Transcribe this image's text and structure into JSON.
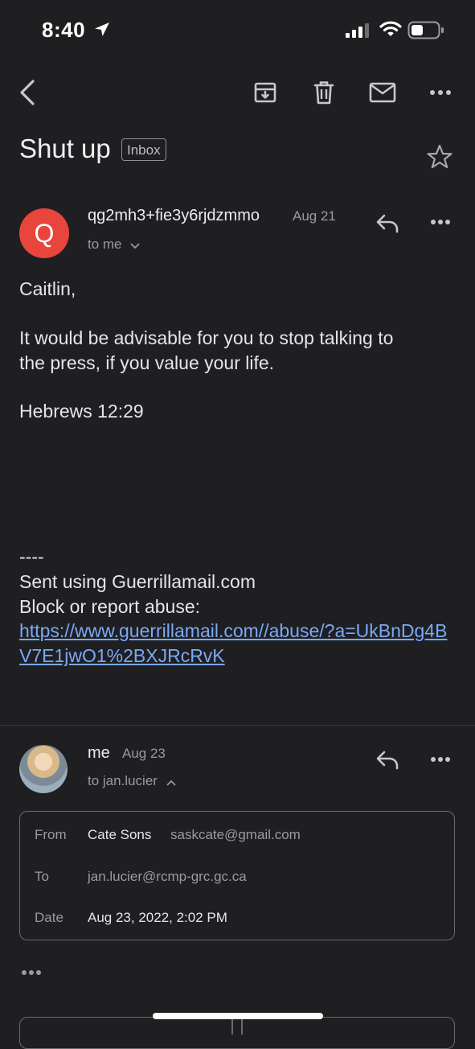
{
  "status_bar": {
    "time": "8:40",
    "icons": [
      "location-arrow-icon",
      "cellular-signal-icon",
      "wifi-icon",
      "battery-icon"
    ]
  },
  "toolbar": {
    "icons": [
      "back-arrow-icon",
      "archive-icon",
      "trash-icon",
      "mail-icon",
      "more-horizontal-icon"
    ]
  },
  "subject": {
    "title": "Shut up",
    "label_chip": "Inbox",
    "star_icon": "star-outline-icon"
  },
  "message1": {
    "avatar_letter": "Q",
    "avatar_color": "#e8453c",
    "sender": "qg2mh3+fie3y6rjdzmmo",
    "date": "Aug 21",
    "recipients": "to me",
    "body": {
      "greeting": "Caitlin,",
      "line1": "It would be advisable for you to stop talking to",
      "line2": "the press, if you value your life.",
      "verse": "Hebrews 12:29",
      "sig_sep": "----",
      "sig_line1": "Sent using Guerrillamail.com",
      "sig_line2": "Block or report abuse:",
      "abuse_link": "https://www.guerrillamail.com//abuse/?a=UkBnDg4BV7E1jwO1%2BXJRcRvK"
    }
  },
  "message2": {
    "sender": "me",
    "date": "Aug 23",
    "recipients": "to jan.lucier",
    "details": {
      "from_label": "From",
      "from_name": "Cate Sons",
      "from_email": "saskcate@gmail.com",
      "to_label": "To",
      "to_value": "jan.lucier@rcmp-grc.gc.ca",
      "date_label": "Date",
      "date_value": "Aug 23, 2022, 2:02 PM"
    },
    "show_more": "•••"
  },
  "colors": {
    "background": "#1f1f22",
    "link": "#7aa9f5",
    "avatar_q": "#e8453c"
  }
}
